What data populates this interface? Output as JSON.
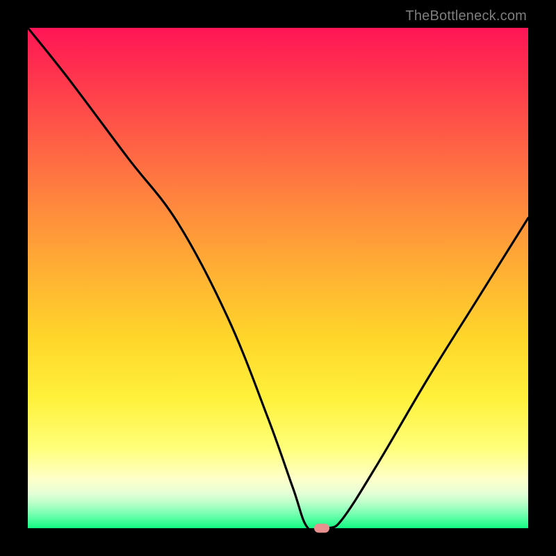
{
  "watermark": "TheBottleneck.com",
  "chart_data": {
    "type": "line",
    "title": "",
    "xlabel": "",
    "ylabel": "",
    "xlim": [
      0,
      100
    ],
    "ylim": [
      0,
      100
    ],
    "series": [
      {
        "name": "bottleneck-curve",
        "x": [
          0,
          8,
          20,
          30,
          40,
          48,
          53,
          56,
          60,
          63,
          70,
          80,
          90,
          100
        ],
        "values": [
          100,
          90,
          74,
          61,
          42,
          22,
          8,
          0,
          0,
          2,
          13,
          30,
          46,
          62
        ]
      }
    ],
    "marker": {
      "x": 58.7,
      "y": 0
    },
    "gradient_stops": [
      {
        "pos": 0,
        "color": "#ff1556"
      },
      {
        "pos": 50,
        "color": "#ffb433"
      },
      {
        "pos": 84,
        "color": "#ffff7a"
      },
      {
        "pos": 100,
        "color": "#12fa82"
      }
    ]
  }
}
